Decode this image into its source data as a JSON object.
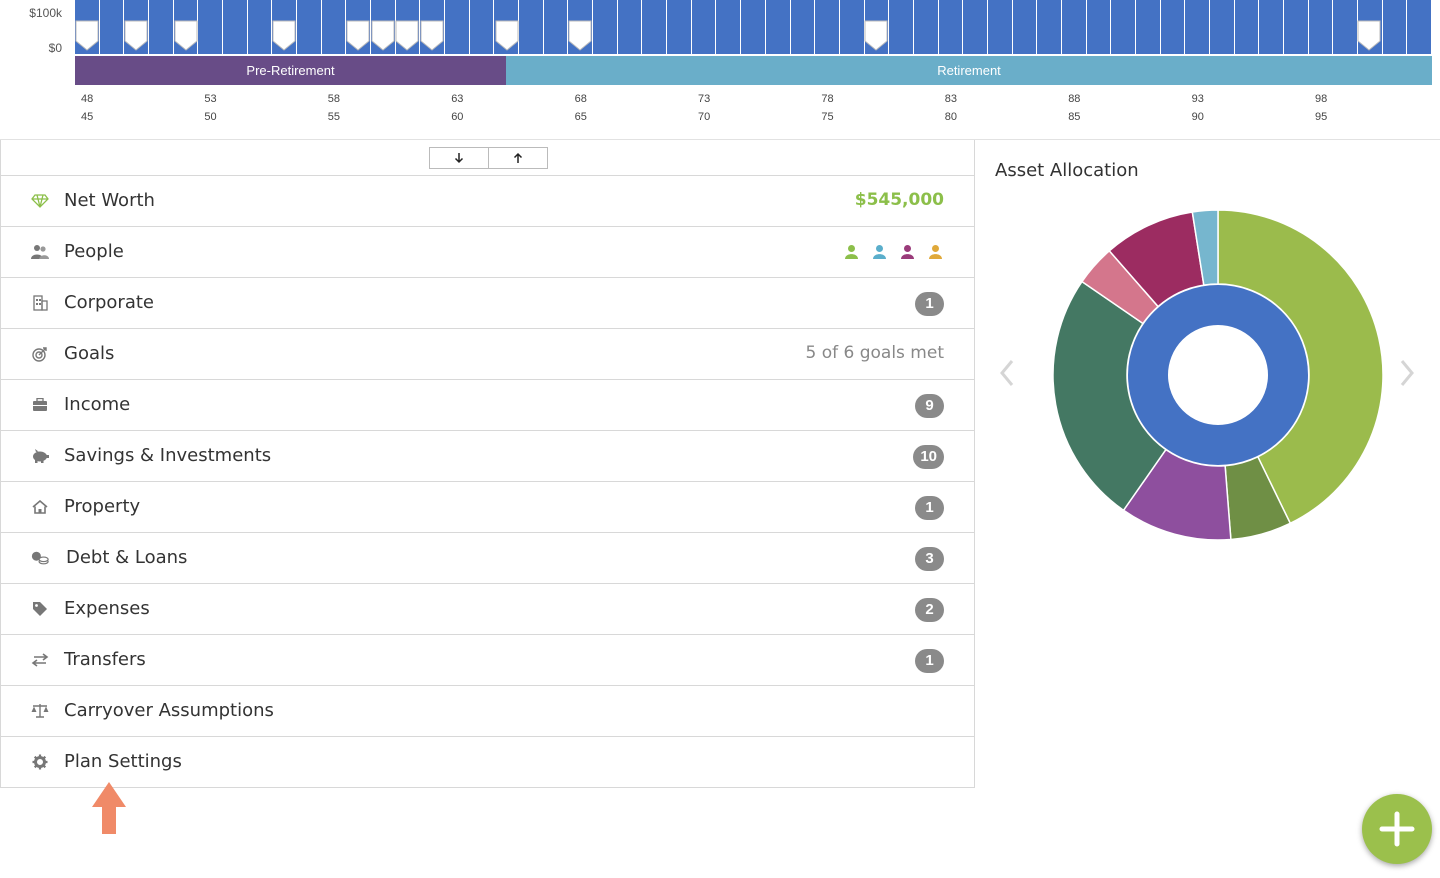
{
  "timeline": {
    "y_labels": {
      "top": "$100k",
      "bottom": "$0"
    },
    "phases": {
      "pre": "Pre-Retirement",
      "post": "Retirement"
    },
    "ages_primary": [
      "48",
      "53",
      "58",
      "63",
      "68",
      "73",
      "78",
      "83",
      "88",
      "93",
      "98"
    ],
    "ages_secondary": [
      "45",
      "50",
      "55",
      "60",
      "65",
      "70",
      "75",
      "80",
      "85",
      "90",
      "95"
    ],
    "bar_count": 55,
    "event_marker_count": 11
  },
  "sort": {
    "down_icon": "arrow-down-icon",
    "up_icon": "arrow-up-icon"
  },
  "rows": [
    {
      "label": "Net Worth",
      "icon": "diamond-icon",
      "value": "$545,000"
    },
    {
      "label": "People",
      "icon": "people-icon"
    },
    {
      "label": "Corporate",
      "icon": "building-icon",
      "badge": "1"
    },
    {
      "label": "Goals",
      "icon": "target-icon",
      "value": "5 of 6 goals met"
    },
    {
      "label": "Income",
      "icon": "briefcase-icon",
      "badge": "9"
    },
    {
      "label": "Savings & Investments",
      "icon": "piggy-bank-icon",
      "badge": "10"
    },
    {
      "label": "Property",
      "icon": "house-icon",
      "badge": "1"
    },
    {
      "label": "Debt & Loans",
      "icon": "coins-icon",
      "badge": "3"
    },
    {
      "label": "Expenses",
      "icon": "tag-icon",
      "badge": "2"
    },
    {
      "label": "Transfers",
      "icon": "transfer-arrows-icon",
      "badge": "1"
    },
    {
      "label": "Carryover Assumptions",
      "icon": "scales-icon"
    },
    {
      "label": "Plan Settings",
      "icon": "gear-icon"
    }
  ],
  "people_colors": [
    "#8cbf4a",
    "#5aaecb",
    "#9a3b7a",
    "#e0a93a"
  ],
  "allocation": {
    "title": "Asset Allocation",
    "inner_color": "#4472c4",
    "outer_segments": [
      {
        "color": "#9bbb4c",
        "value": 43
      },
      {
        "color": "#6f8f45",
        "value": 6
      },
      {
        "color": "#8e4f9e",
        "value": 11
      },
      {
        "color": "#447863",
        "value": 25
      },
      {
        "color": "#d4768c",
        "value": 4
      },
      {
        "color": "#9c2c61",
        "value": 9
      },
      {
        "color": "#76b6ce",
        "value": 2.5
      }
    ]
  },
  "colors": {
    "bar": "#4472c4",
    "pre_retirement": "#684c87",
    "retirement": "#6aaec9",
    "fab": "#9bc04c",
    "pointer": "#f08a68"
  }
}
